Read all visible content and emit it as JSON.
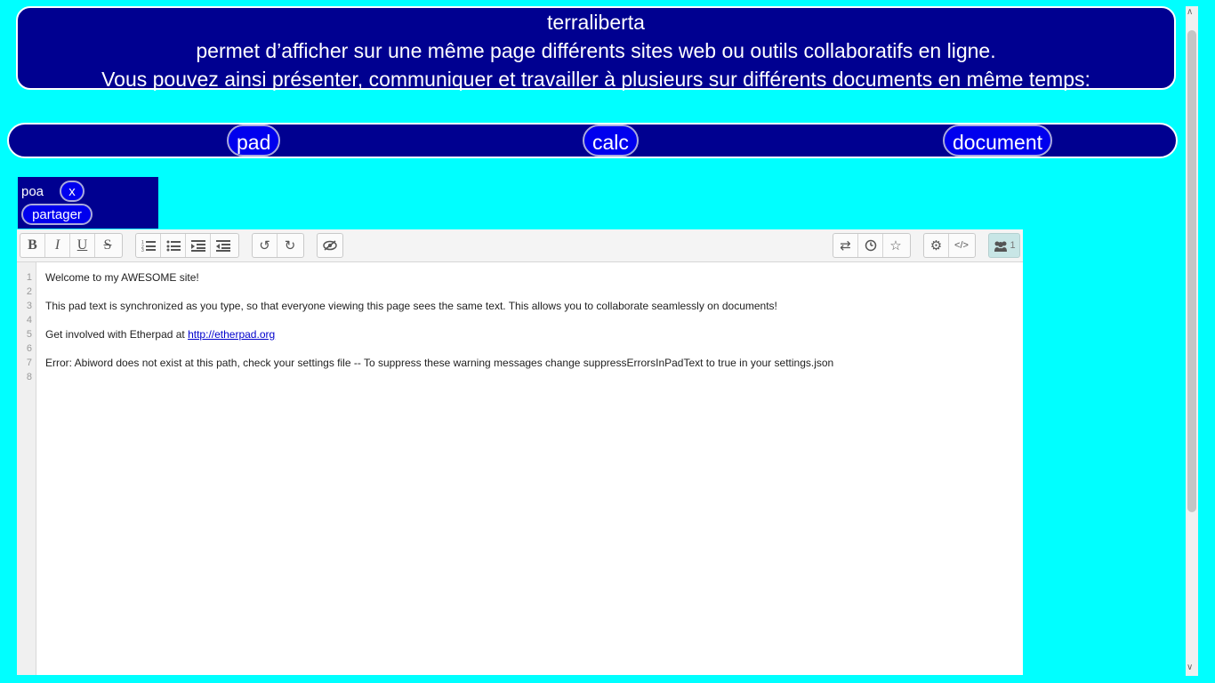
{
  "header": {
    "title": "terraliberta",
    "line1": "permet d’afficher sur une même page différents sites web ou outils collaboratifs en ligne.",
    "line2": "Vous pouvez ainsi présenter, communiquer et travailler à plusieurs sur différents documents en même temps:"
  },
  "nav": {
    "pad": "pad",
    "calc": "calc",
    "document": "document"
  },
  "panel": {
    "name": "poa",
    "close": "x",
    "share": "partager"
  },
  "toolbar": {
    "bold": "B",
    "italic": "I",
    "underline": "U",
    "strike": "S",
    "users_count": "1"
  },
  "editor": {
    "line_numbers": [
      "1",
      "2",
      "3",
      "4",
      "5",
      "6",
      "7",
      "8"
    ],
    "line1": "Welcome to my AWESOME site!",
    "line3": "This pad text is synchronized as you type, so that everyone viewing this page sees the same text. This allows you to collaborate seamlessly on documents!",
    "line5_prefix": "Get involved with Etherpad at ",
    "line5_link": "http://etherpad.org",
    "line7": "Error: Abiword does not exist at this path, check your settings file -- To suppress these warning messages change suppressErrorsInPadText to true in your settings.json"
  },
  "icons": {
    "toolbar": [
      "ordered-list-icon",
      "unordered-list-icon",
      "indent-icon",
      "outdent-icon",
      "undo-icon",
      "redo-icon",
      "clear-authorship-icon",
      "import-export-icon",
      "timeslider-icon",
      "star-icon",
      "settings-icon",
      "embed-icon",
      "users-icon"
    ]
  },
  "colors": {
    "page_bg": "#00ffff",
    "panel_bg": "#000090",
    "button_bg": "#0000ee"
  }
}
